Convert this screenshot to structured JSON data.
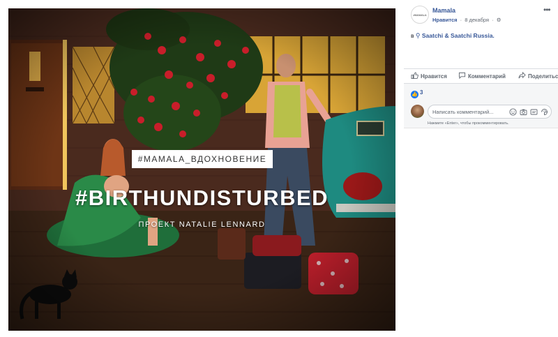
{
  "photo": {
    "tag": "#MAMALA_ВДОХНОВЕНИЕ",
    "title": "#BIRTHUNDISTURBED",
    "subtitle": "ПРОЕКТ NATALIE LENNARD"
  },
  "post": {
    "avatar_text": "#MAMALA",
    "page_name": "Mamala",
    "like_link": "Нравится",
    "date": "8 декабря",
    "privacy_icon": "gear-icon",
    "more_icon": "more-icon",
    "location_prefix": "в",
    "location_name": "Saatchi & Saatchi Russia."
  },
  "actions": {
    "like": "Нравится",
    "comment": "Комментарий",
    "share": "Поделиться"
  },
  "feedback": {
    "like_count": "3",
    "comment_placeholder": "Написать комментарий...",
    "hint": "Нажмите «Enter», чтобы прокомментировать."
  },
  "colors": {
    "link": "#385898",
    "like_blue": "#1877f2",
    "muted": "#606770",
    "panel_bg": "#f5f6f7"
  }
}
